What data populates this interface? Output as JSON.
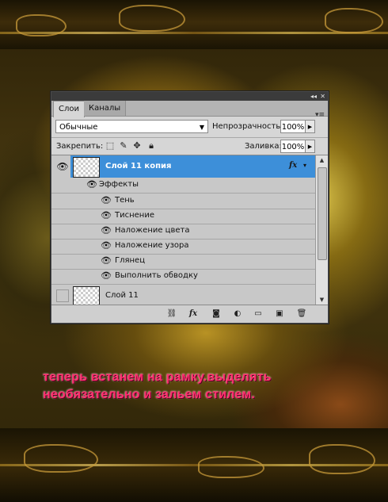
{
  "panel": {
    "tabs": [
      "Слои",
      "Каналы"
    ],
    "blend_mode": "Обычные",
    "opacity_label": "Непрозрачность:",
    "opacity_value": "100%",
    "lock_label": "Закрепить:",
    "fill_label": "Заливка:",
    "fill_value": "100%",
    "layers": [
      {
        "name": "Слой 11 копия",
        "selected": true,
        "has_fx": true
      },
      {
        "name": "Слой 11",
        "selected": false,
        "has_fx": false
      }
    ],
    "effects_label": "Эффекты",
    "effects": [
      "Тень",
      "Тиснение",
      "Наложение цвета",
      "Наложение узора",
      "Глянец",
      "Выполнить обводку"
    ],
    "fx_badge": "fx",
    "bottom_icons": [
      "link-icon",
      "fx-icon",
      "mask-icon",
      "adjustment-icon",
      "folder-icon",
      "new-layer-icon",
      "trash-icon"
    ],
    "lock_icons": [
      "lock-transparent-icon",
      "lock-brush-icon",
      "lock-move-icon",
      "lock-all-icon"
    ]
  },
  "caption": {
    "line1": "теперь встанем на рамку.выделять",
    "line2": "необязательно и зальем стилем."
  },
  "colors": {
    "selected_layer": "#3d8fd9",
    "caption": "#ff2f6e"
  }
}
